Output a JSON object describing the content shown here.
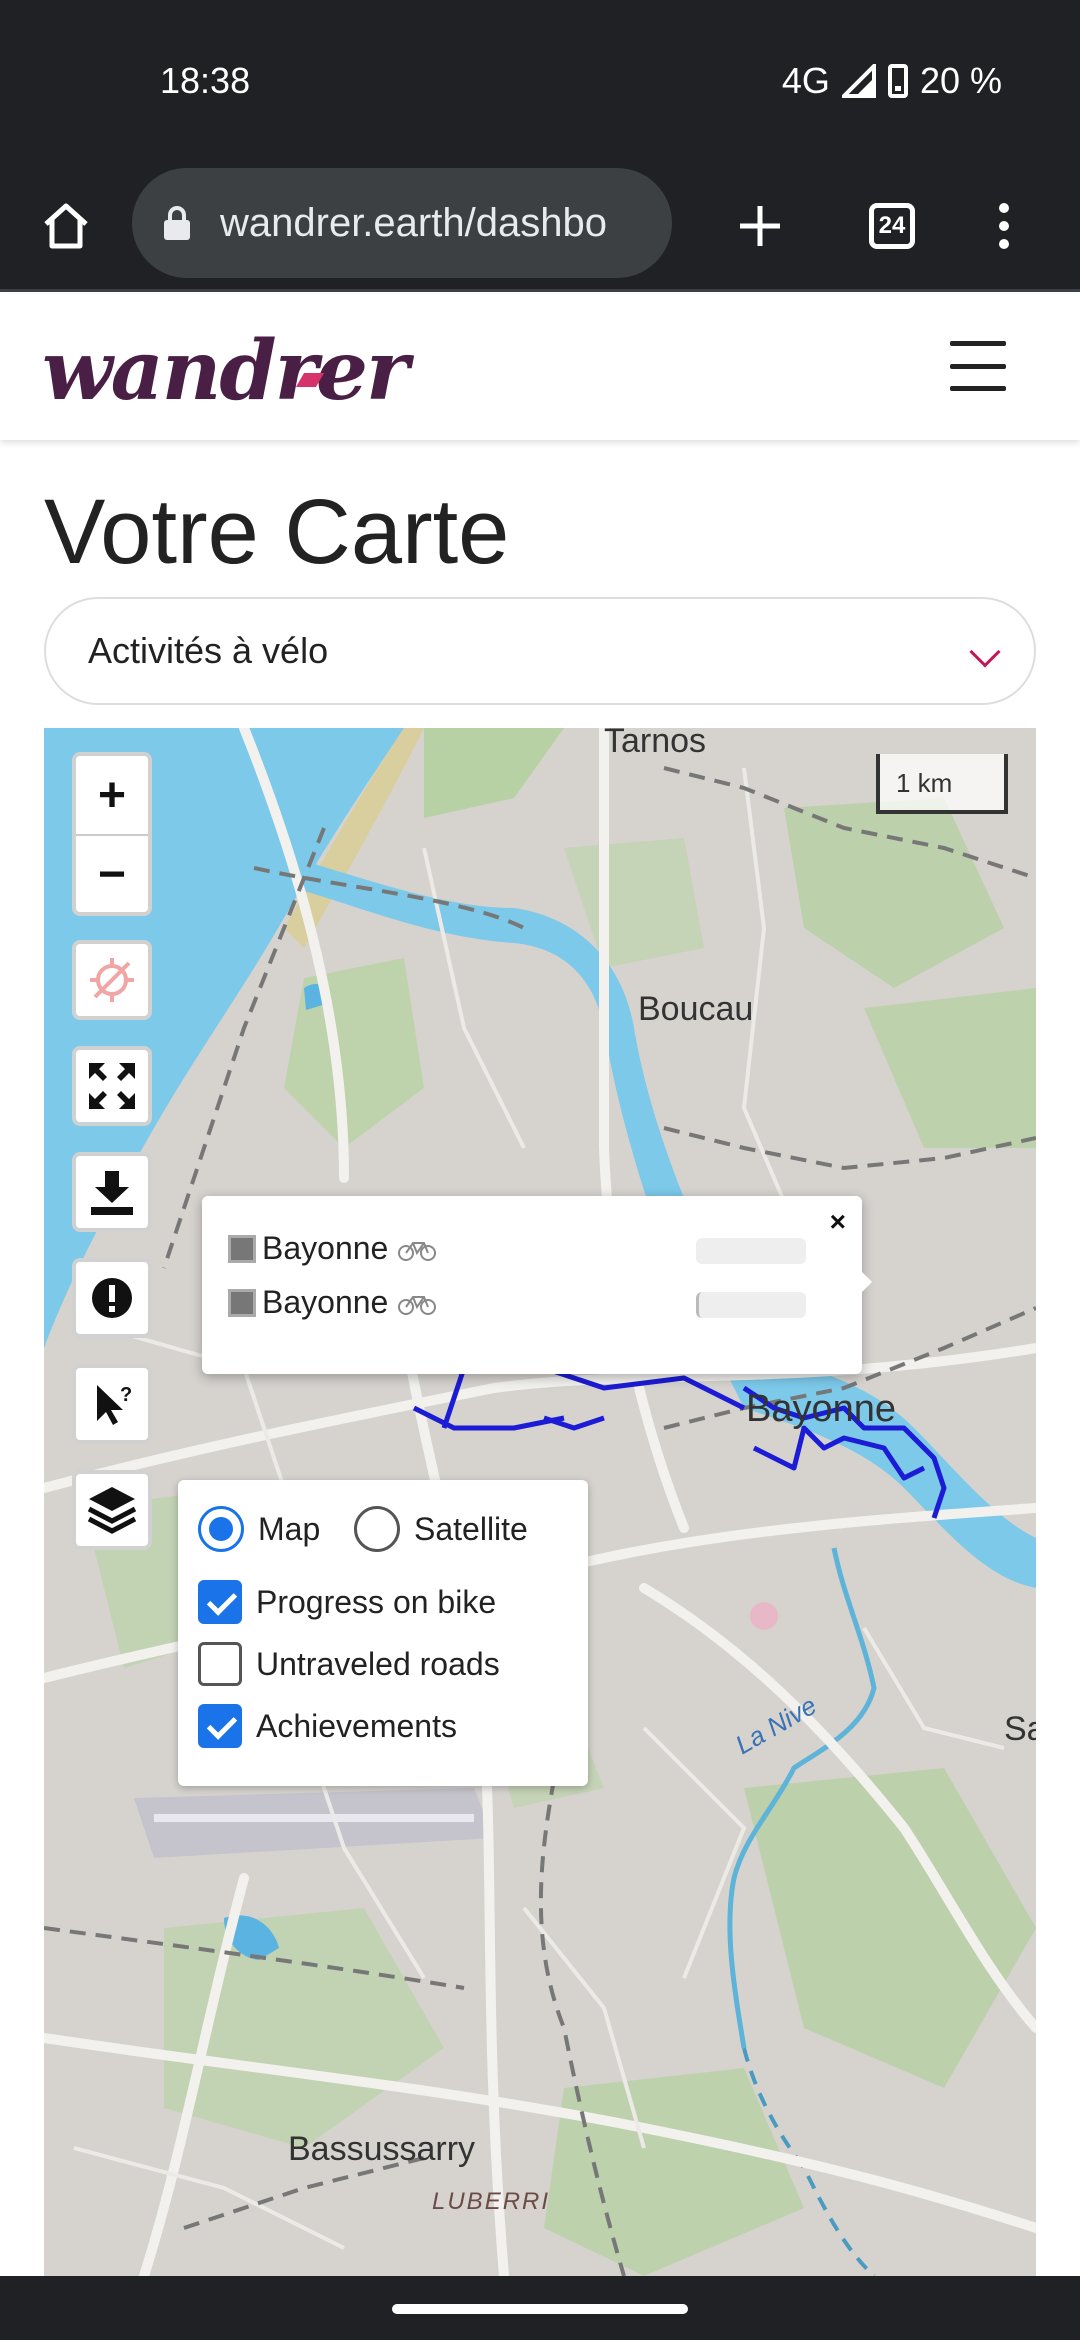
{
  "status": {
    "time": "18:38",
    "network": "4G",
    "battery": "20 %"
  },
  "browser": {
    "url": "wandrer.earth/dashbo",
    "tab_count": "24"
  },
  "site": {
    "logo": "wandrer",
    "title": "Votre Carte",
    "activity_select": "Activités à vélo"
  },
  "map": {
    "scale": "1 km",
    "places": {
      "tarnos": "Tarnos",
      "boucau": "Boucau",
      "bayonne": "Bayonne",
      "la_nive": "La Nive",
      "sa": "Sa",
      "bassussarry": "Bassussarry",
      "luberri": "LUBERRI"
    },
    "controls": [
      "zoom-in",
      "zoom-out",
      "locate-disabled",
      "fullscreen",
      "download",
      "report",
      "cursor-help",
      "layers"
    ],
    "zoom_in": "+",
    "zoom_out": "−"
  },
  "popup": {
    "close": "×",
    "rows": [
      {
        "label": "Bayonne"
      },
      {
        "label": "Bayonne"
      }
    ]
  },
  "layers": {
    "base": [
      {
        "label": "Map",
        "selected": true
      },
      {
        "label": "Satellite",
        "selected": false
      }
    ],
    "overlays": [
      {
        "label": "Progress on bike",
        "checked": true
      },
      {
        "label": "Untraveled roads",
        "checked": false
      },
      {
        "label": "Achievements",
        "checked": true
      }
    ]
  }
}
